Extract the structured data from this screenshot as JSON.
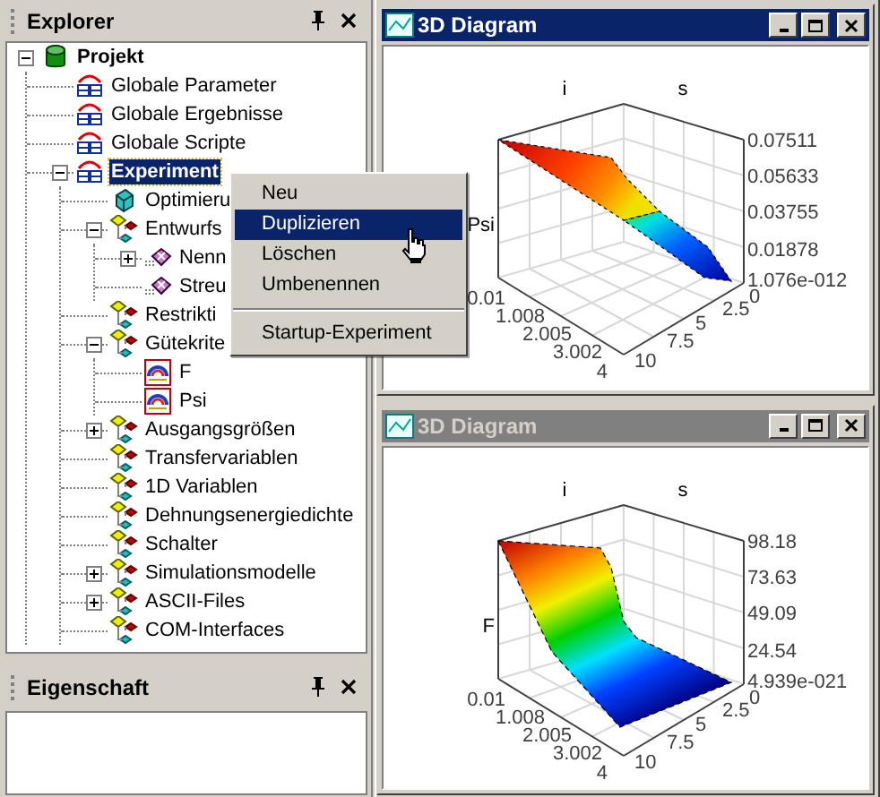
{
  "explorer": {
    "title": "Explorer",
    "tree": [
      {
        "label": "Projekt",
        "kind": "project",
        "selected": false,
        "expanded": true,
        "children": [
          {
            "label": "Globale Parameter",
            "kind": "group",
            "selected": false
          },
          {
            "label": "Globale Ergebnisse",
            "kind": "group",
            "selected": false
          },
          {
            "label": "Globale Scripte",
            "kind": "group",
            "selected": false
          },
          {
            "label": "Experiment",
            "kind": "group",
            "selected": true,
            "expanded": true,
            "children": [
              {
                "label": "Optimieru",
                "kind": "optimizer",
                "selected": false
              },
              {
                "label": "Entwurfs",
                "kind": "variable",
                "selected": false,
                "expanded": true,
                "children": [
                  {
                    "label": "Nenn",
                    "kind": "design",
                    "selected": false,
                    "expanded": false
                  },
                  {
                    "label": "Streu",
                    "kind": "design",
                    "selected": false
                  }
                ]
              },
              {
                "label": "Restrikti",
                "kind": "variable",
                "selected": false
              },
              {
                "label": "Gütekrite",
                "kind": "variable",
                "selected": false,
                "expanded": true,
                "children": [
                  {
                    "label": "F",
                    "kind": "chart",
                    "selected": false
                  },
                  {
                    "label": "Psi",
                    "kind": "chart",
                    "selected": false
                  }
                ]
              },
              {
                "label": "Ausgangsgrößen",
                "kind": "variable",
                "selected": false,
                "expanded": false
              },
              {
                "label": "Transfervariablen",
                "kind": "variable",
                "selected": false
              },
              {
                "label": "1D Variablen",
                "kind": "variable",
                "selected": false
              },
              {
                "label": "Dehnungsenergiedichte",
                "kind": "variable",
                "selected": false
              },
              {
                "label": "Schalter",
                "kind": "variable",
                "selected": false
              },
              {
                "label": "Simulationsmodelle",
                "kind": "variable",
                "selected": false,
                "expanded": false
              },
              {
                "label": "ASCII-Files",
                "kind": "variable",
                "selected": false,
                "expanded": false
              },
              {
                "label": "COM-Interfaces",
                "kind": "variable",
                "selected": false
              }
            ]
          }
        ]
      }
    ]
  },
  "properties_panel": {
    "title": "Eigenschaft"
  },
  "context_menu": [
    {
      "kind": "item",
      "label": "Neu",
      "selected": false
    },
    {
      "kind": "item",
      "label": "Duplizieren",
      "selected": true
    },
    {
      "kind": "item",
      "label": "Löschen",
      "selected": false
    },
    {
      "kind": "item",
      "label": "Umbenennen",
      "selected": false
    },
    {
      "kind": "separator"
    },
    {
      "kind": "item",
      "label": "Startup-Experiment",
      "selected": false
    }
  ],
  "windows": [
    {
      "title": "3D Diagram",
      "active": true,
      "plot": {
        "axis_i": "i",
        "axis_s": "s",
        "value_label": "Psi",
        "value_ticks": [
          "0.07511",
          "0.05633",
          "0.03755",
          "0.01878",
          "1.076e-012"
        ],
        "i_ticks": [
          "0.01",
          "1.008",
          "2.005",
          "3.002",
          "4"
        ],
        "s_ticks": [
          "0",
          "2.5",
          "5",
          "7.5",
          "10"
        ]
      }
    },
    {
      "title": "3D Diagram",
      "active": false,
      "plot": {
        "axis_i": "i",
        "axis_s": "s",
        "value_label": "F",
        "value_ticks": [
          "98.18",
          "73.63",
          "49.09",
          "24.54",
          "4.939e-021"
        ],
        "i_ticks": [
          "0.01",
          "1.008",
          "2.005",
          "3.002",
          "4"
        ],
        "s_ticks": [
          "0",
          "2.5",
          "5",
          "7.5",
          "10"
        ]
      }
    }
  ]
}
